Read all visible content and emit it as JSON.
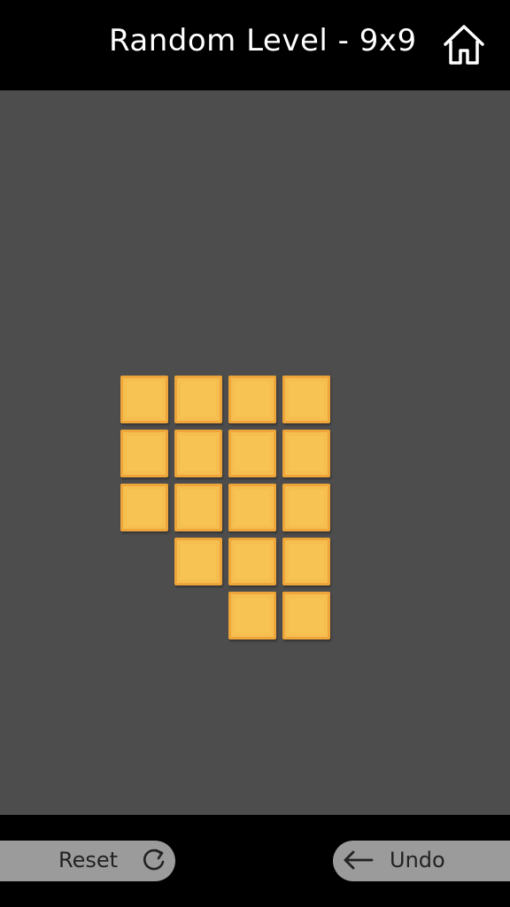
{
  "header": {
    "title": "Random Level - 9x9",
    "home_icon": "home-icon"
  },
  "board": {
    "grid_size": "9x9",
    "tile_color": "#f5be4f",
    "tile_border_color": "#eea63a",
    "player_icon": "smiley-face-icon",
    "player_color": "#7ec8ef",
    "player": {
      "row": 0,
      "col": 4
    },
    "tiles": [
      {
        "row": 1,
        "col": 2
      },
      {
        "row": 1,
        "col": 3
      },
      {
        "row": 1,
        "col": 4
      },
      {
        "row": 1,
        "col": 5
      },
      {
        "row": 2,
        "col": 2
      },
      {
        "row": 2,
        "col": 3
      },
      {
        "row": 2,
        "col": 4
      },
      {
        "row": 2,
        "col": 5
      },
      {
        "row": 3,
        "col": 2
      },
      {
        "row": 3,
        "col": 3
      },
      {
        "row": 3,
        "col": 4
      },
      {
        "row": 3,
        "col": 5
      },
      {
        "row": 4,
        "col": 3
      },
      {
        "row": 4,
        "col": 4
      },
      {
        "row": 4,
        "col": 5
      },
      {
        "row": 5,
        "col": 4
      },
      {
        "row": 5,
        "col": 5
      }
    ]
  },
  "footer": {
    "reset_label": "Reset",
    "reset_icon": "refresh-icon",
    "undo_label": "Undo",
    "undo_icon": "arrow-left-icon"
  }
}
